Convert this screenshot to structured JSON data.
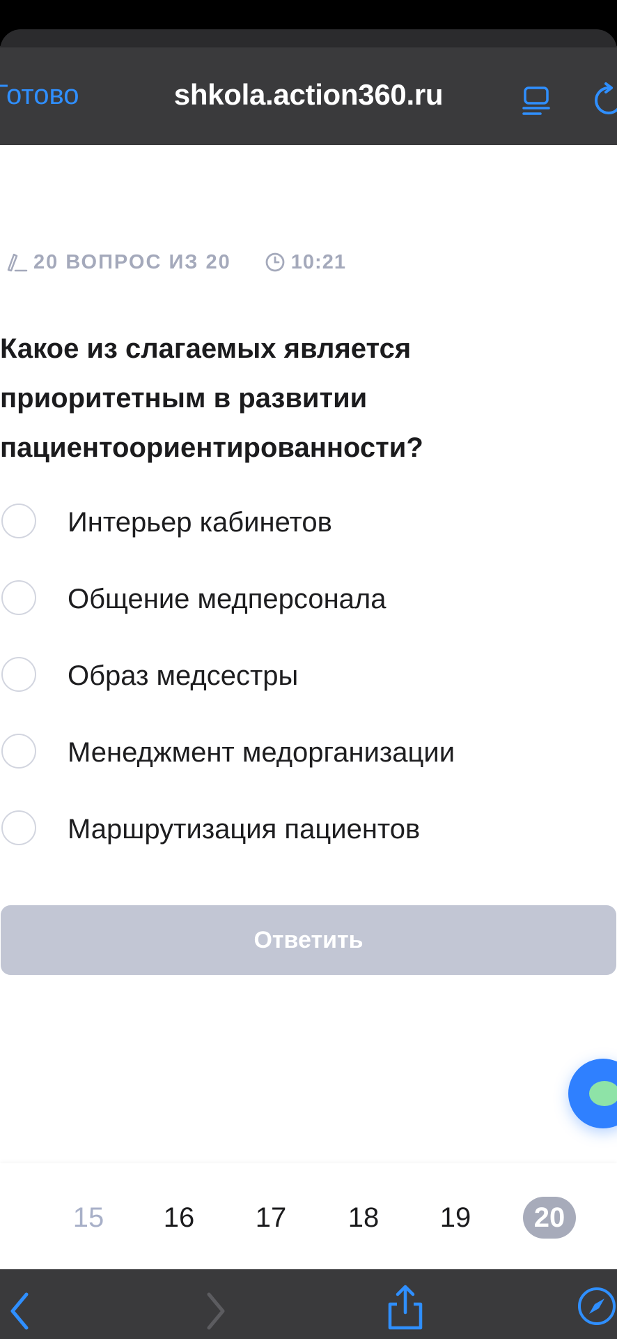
{
  "safari": {
    "done_label": "Готово",
    "url": "shkola.action360.ru"
  },
  "quiz": {
    "progress_label": "20 ВОПРОС ИЗ 20",
    "timer": "10:21",
    "question": "Какое из слагаемых является приоритетным в развитии пациентоориентированности?",
    "options": [
      "Интерьер кабинетов",
      "Общение медперсонала",
      "Образ медсестры",
      "Менеджмент медорганизации",
      "Маршрутизация пациентов"
    ],
    "answer_button": "Ответить"
  },
  "pager": {
    "pages": [
      "15",
      "16",
      "17",
      "18",
      "19",
      "20"
    ],
    "current": "20"
  },
  "colors": {
    "accent_blue": "#2f8fff",
    "muted": "#a4a9bb",
    "button_disabled": "#c2c6d4",
    "chat_green": "#8ee3a7"
  }
}
